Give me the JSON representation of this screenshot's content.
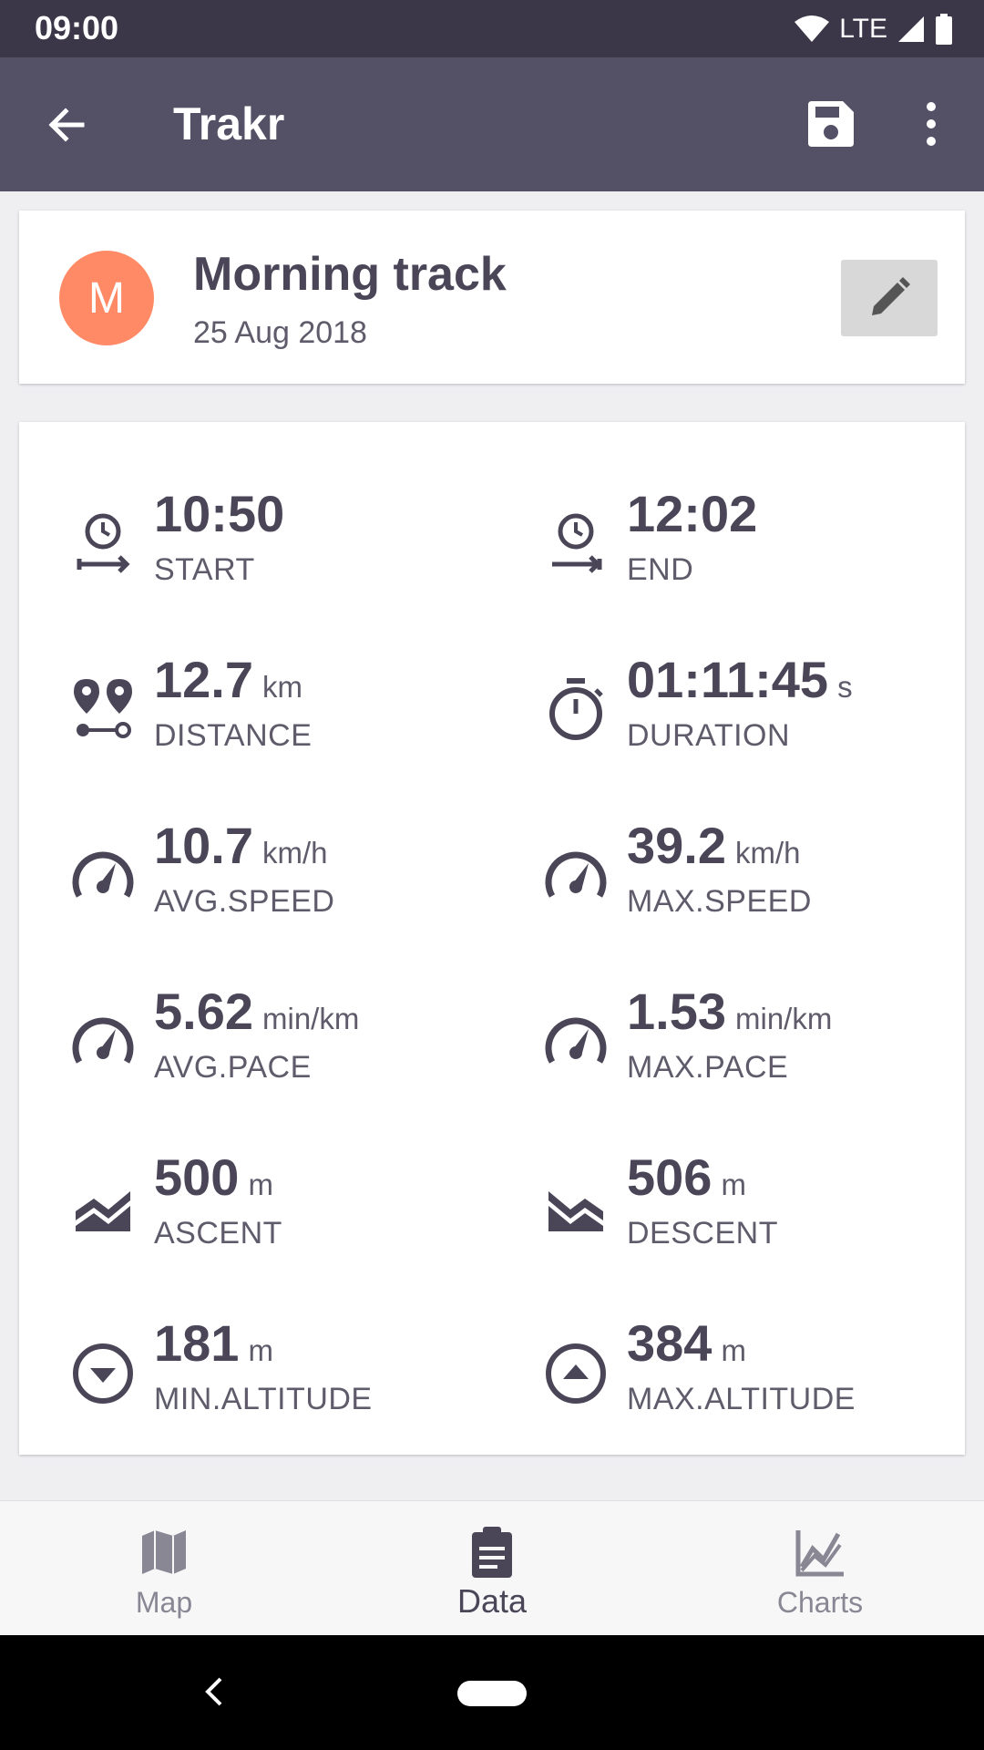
{
  "status_bar": {
    "time": "09:00",
    "network": "LTE"
  },
  "app_bar": {
    "title": "Trakr",
    "back_icon": "arrow-back-icon",
    "save_icon": "save-icon",
    "more_icon": "more-vert-icon"
  },
  "track": {
    "avatar_letter": "M",
    "name": "Morning track",
    "date": "25 Aug 2018",
    "edit_icon": "pencil-icon"
  },
  "stats": [
    {
      "value": "10:50",
      "unit": "",
      "label": "START",
      "icon": "clock-start-icon"
    },
    {
      "value": "12:02",
      "unit": "",
      "label": "END",
      "icon": "clock-end-icon"
    },
    {
      "value": "12.7",
      "unit": "km",
      "label": "DISTANCE",
      "icon": "map-marker-distance-icon"
    },
    {
      "value": "01:11:45",
      "unit": "s",
      "label": "DURATION",
      "icon": "timer-icon"
    },
    {
      "value": "10.7",
      "unit": "km/h",
      "label": "AVG.SPEED",
      "icon": "speedometer-icon"
    },
    {
      "value": "39.2",
      "unit": "km/h",
      "label": "MAX.SPEED",
      "icon": "speedometer-icon"
    },
    {
      "value": "5.62",
      "unit": "min/km",
      "label": "AVG.PACE",
      "icon": "speedometer-icon"
    },
    {
      "value": "1.53",
      "unit": "min/km",
      "label": "MAX.PACE",
      "icon": "speedometer-icon"
    },
    {
      "value": "500",
      "unit": "m",
      "label": "ASCENT",
      "icon": "elevation-rise-icon"
    },
    {
      "value": "506",
      "unit": "m",
      "label": "DESCENT",
      "icon": "elevation-decline-icon"
    },
    {
      "value": "181",
      "unit": "m",
      "label": "MIN.ALTITUDE",
      "icon": "arrow-down-circle-icon"
    },
    {
      "value": "384",
      "unit": "m",
      "label": "MAX.ALTITUDE",
      "icon": "arrow-up-circle-icon"
    }
  ],
  "bottom_nav": [
    {
      "label": "Map",
      "icon": "map-icon",
      "active": false
    },
    {
      "label": "Data",
      "icon": "clipboard-text-icon",
      "active": true
    },
    {
      "label": "Charts",
      "icon": "chart-line-icon",
      "active": false
    }
  ],
  "colors": {
    "status_bar": "#3b3748",
    "app_bar": "#545066",
    "avatar": "#ff8a65",
    "text_primary": "#4a4658"
  }
}
